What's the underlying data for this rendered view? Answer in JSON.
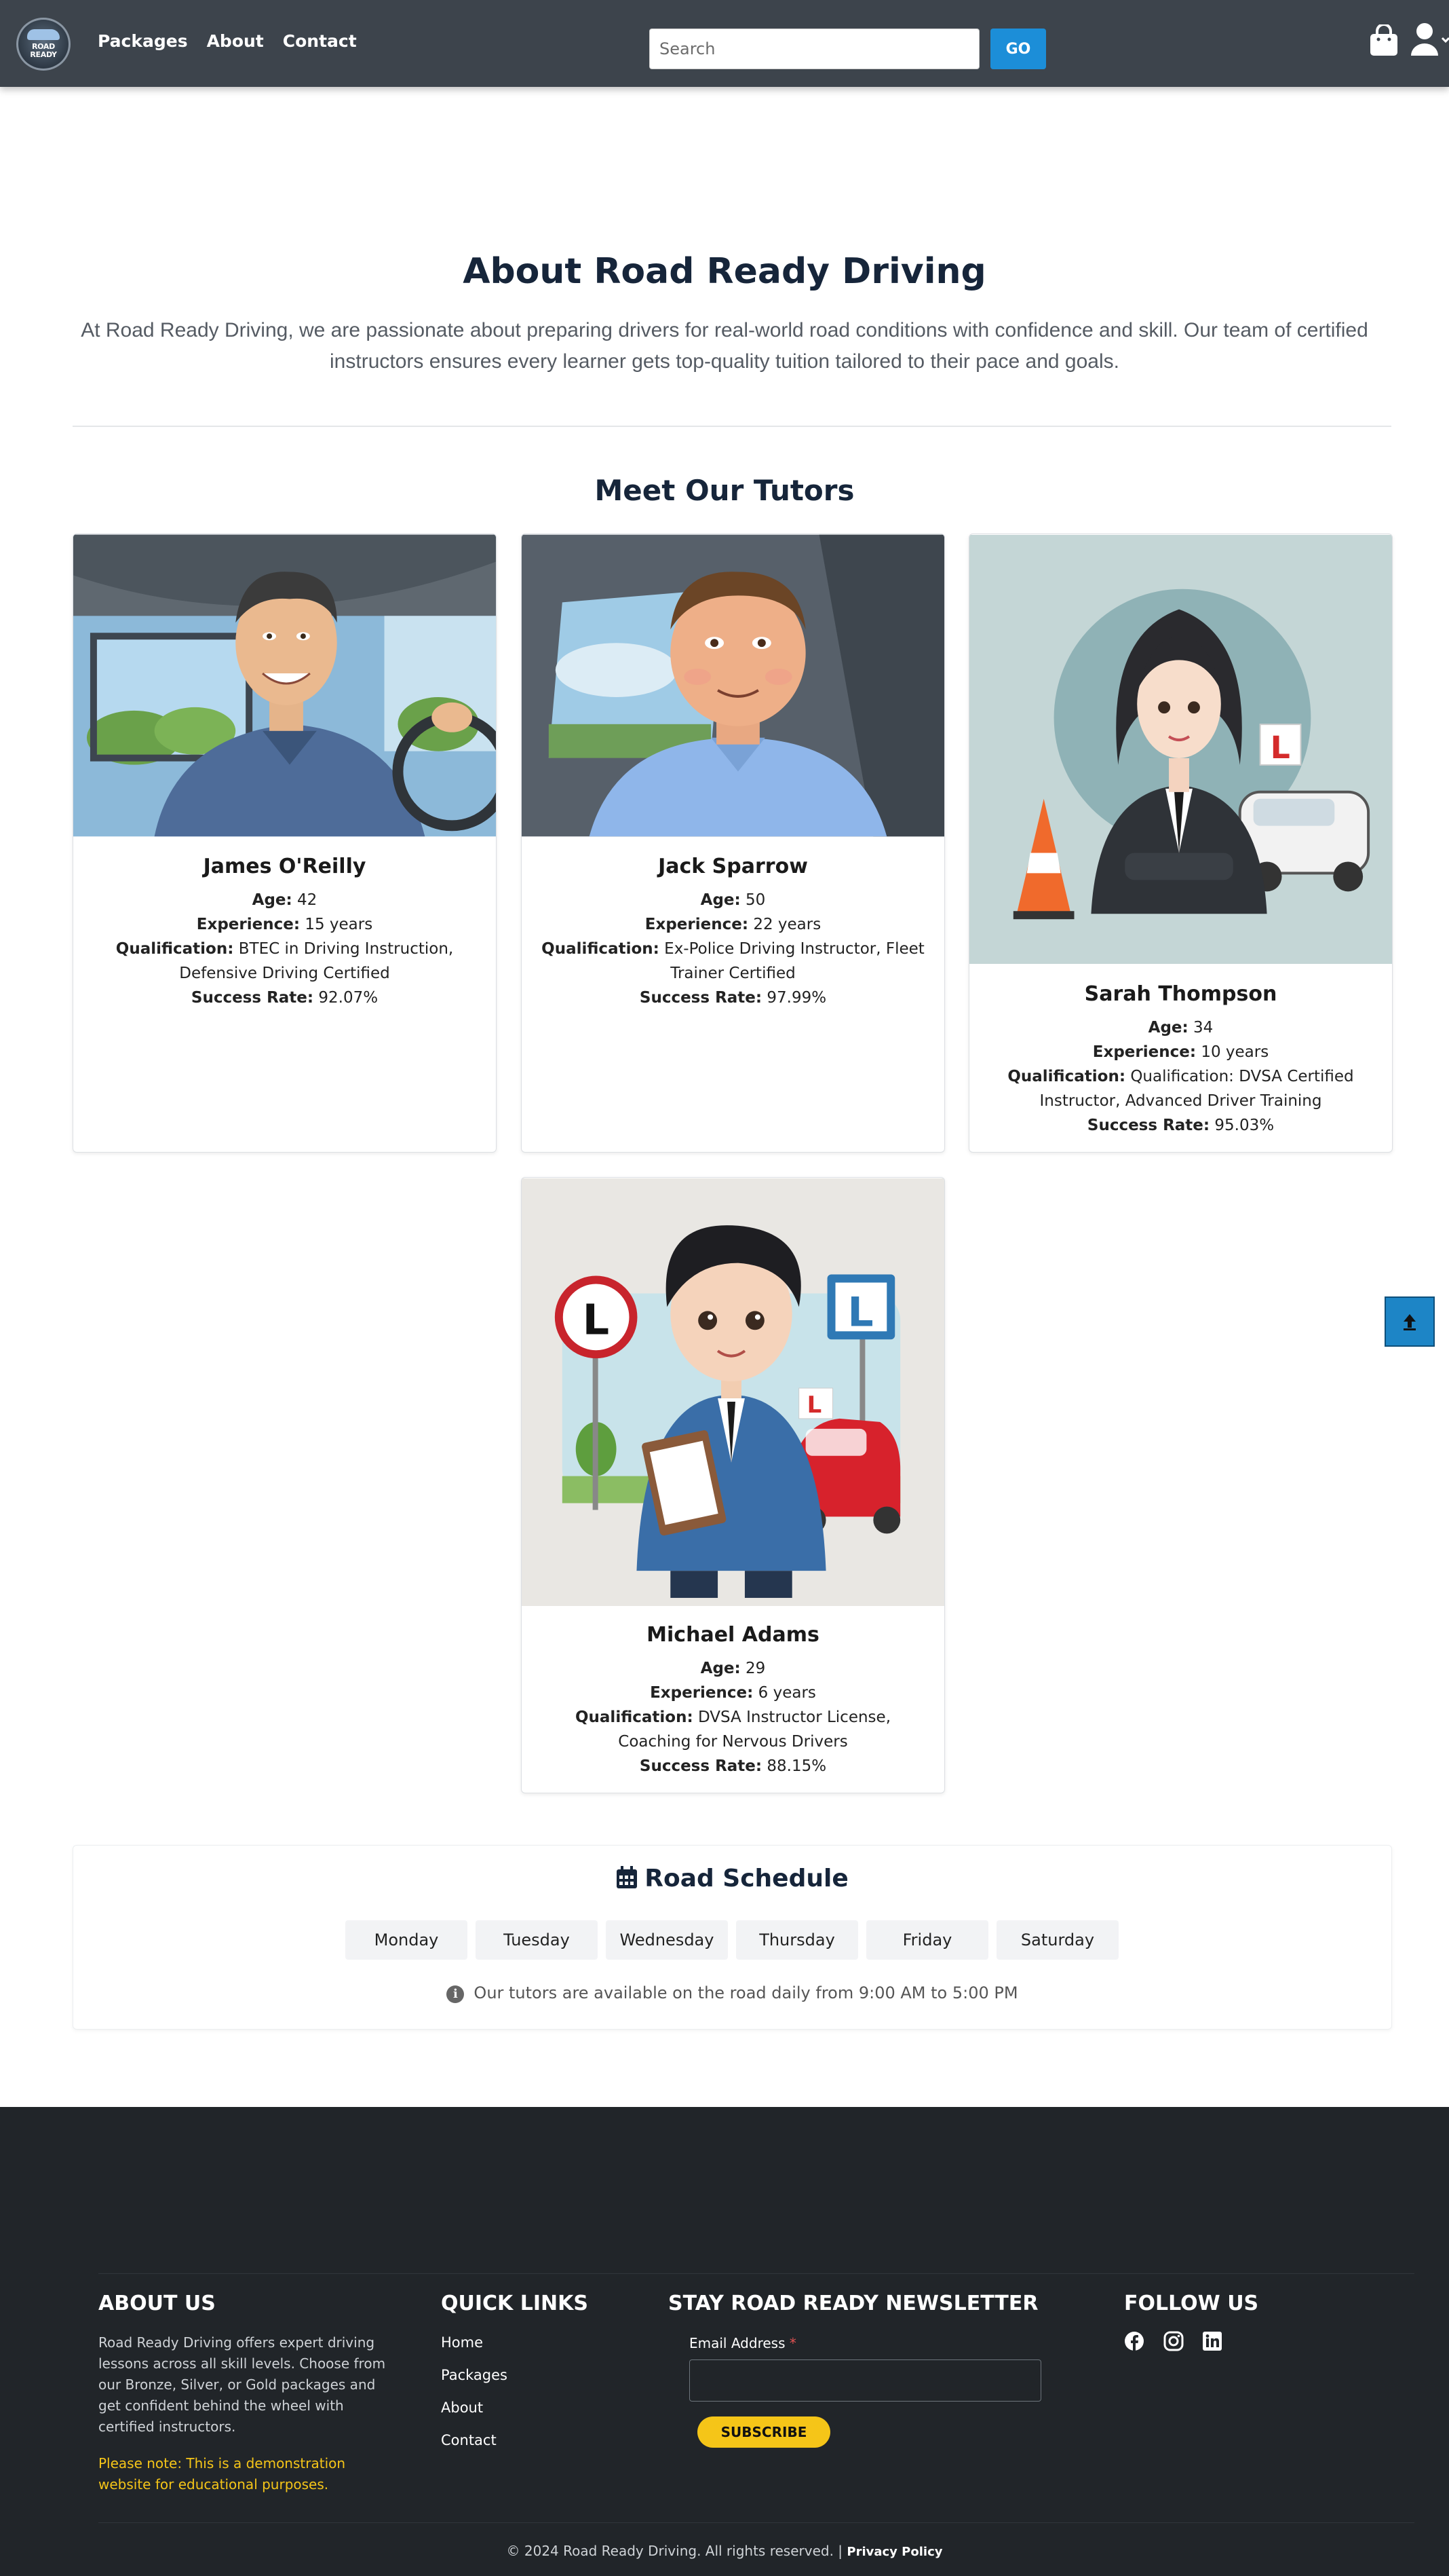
{
  "header": {
    "logo_text": "ROAD READY",
    "nav": [
      "Packages",
      "About",
      "Contact"
    ],
    "search_placeholder": "Search",
    "go_label": "GO"
  },
  "about": {
    "title": "About Road Ready Driving",
    "text": "At Road Ready Driving, we are passionate about preparing drivers for real-world road conditions with confidence and skill. Our team of certified instructors ensures every learner gets top-quality tuition tailored to their pace and goals."
  },
  "tutors": {
    "title": "Meet Our Tutors",
    "labels": {
      "age": "Age:",
      "experience": "Experience:",
      "qualification": "Qualification:",
      "success": "Success Rate:"
    },
    "items": [
      {
        "name": "James O'Reilly",
        "age": "42",
        "experience": "15 years",
        "qualification": "BTEC in Driving Instruction, Defensive Driving Certified",
        "success": "92.07%"
      },
      {
        "name": "Jack Sparrow",
        "age": "50",
        "experience": "22 years",
        "qualification": "Ex-Police Driving Instructor, Fleet Trainer Certified",
        "success": "97.99%"
      },
      {
        "name": "Sarah Thompson",
        "age": "34",
        "experience": "10 years",
        "qualification": "Qualification: DVSA Certified Instructor, Advanced Driver Training",
        "success": "95.03%"
      },
      {
        "name": "Michael Adams",
        "age": "29",
        "experience": "6 years",
        "qualification": "DVSA Instructor License, Coaching for Nervous Drivers",
        "success": "88.15%"
      }
    ]
  },
  "schedule": {
    "title": "Road Schedule",
    "days": [
      "Monday",
      "Tuesday",
      "Wednesday",
      "Thursday",
      "Friday",
      "Saturday"
    ],
    "note": "Our tutors are available on the road daily from 9:00 AM to 5:00 PM"
  },
  "footer": {
    "about_title": "ABOUT US",
    "about_text": "Road Ready Driving offers expert driving lessons across all skill levels. Choose from our Bronze, Silver, or Gold packages and get confident behind the wheel with certified instructors.",
    "note": "Please note: This is a demonstration website for educational purposes.",
    "links_title": "QUICK LINKS",
    "links": [
      "Home",
      "Packages",
      "About",
      "Contact"
    ],
    "newsletter_title": "STAY ROAD READY NEWSLETTER",
    "email_label": "Email Address",
    "required_mark": "*",
    "subscribe_label": "SUBSCRIBE",
    "follow_title": "FOLLOW US",
    "copyright": "© 2024 Road Ready Driving. All rights reserved. |",
    "privacy": "Privacy Policy"
  }
}
